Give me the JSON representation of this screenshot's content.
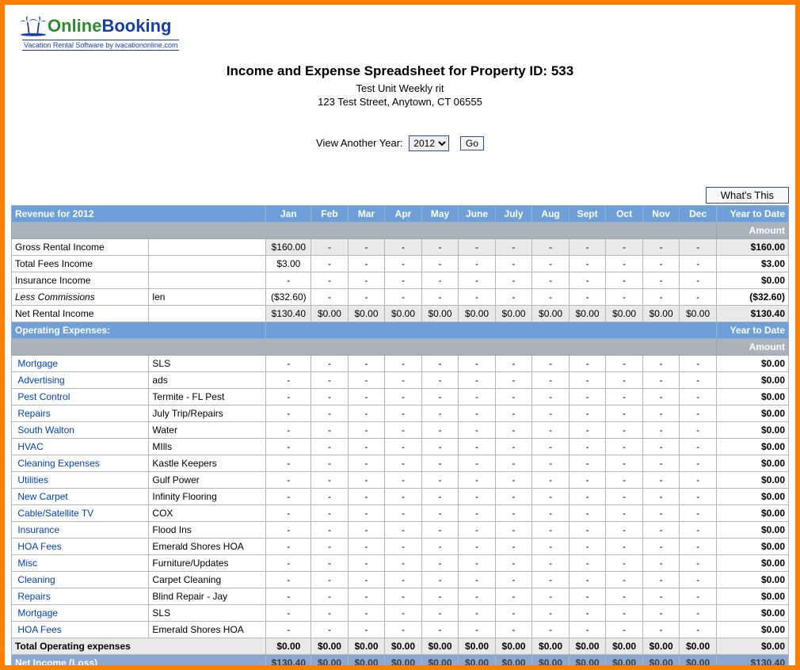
{
  "logo": {
    "text1": "Online",
    "text2": "Booking",
    "tagline": "Vacation Rental Software by ivacationonline.com"
  },
  "header": {
    "title": "Income and Expense Spreadsheet for Property ID: 533",
    "unit": "Test Unit Weekly rit",
    "address": "123 Test Street, Anytown, CT 06555"
  },
  "view_year": {
    "label": "View Another Year:",
    "selected": "2012",
    "go": "Go"
  },
  "whats_this": "What's This",
  "months": [
    "Jan",
    "Feb",
    "Mar",
    "Apr",
    "May",
    "June",
    "July",
    "Aug",
    "Sept",
    "Oct",
    "Nov",
    "Dec"
  ],
  "revenue": {
    "section_label": "Revenue for 2012",
    "ytd_label": "Year to Date",
    "amount_label": "Amount",
    "rows": [
      {
        "label": "Gross Rental Income",
        "desc": "",
        "vals": [
          "$160.00",
          "-",
          "-",
          "-",
          "-",
          "-",
          "-",
          "-",
          "-",
          "-",
          "-",
          "-"
        ],
        "ytd": "$160.00",
        "shade": true
      },
      {
        "label": "Total Fees Income",
        "desc": "",
        "vals": [
          "$3.00",
          "-",
          "-",
          "-",
          "-",
          "-",
          "-",
          "-",
          "-",
          "-",
          "-",
          "-"
        ],
        "ytd": "$3.00"
      },
      {
        "label": "Insurance Income",
        "desc": "",
        "vals": [
          "-",
          "-",
          "-",
          "-",
          "-",
          "-",
          "-",
          "-",
          "-",
          "-",
          "-",
          "-"
        ],
        "ytd": "$0.00"
      },
      {
        "label": "Less Commissions",
        "desc": "len",
        "vals": [
          "($32.60)",
          "-",
          "-",
          "-",
          "-",
          "-",
          "-",
          "-",
          "-",
          "-",
          "-",
          "-"
        ],
        "ytd": "($32.60)",
        "italic": true
      },
      {
        "label": "Net Rental Income",
        "desc": "",
        "vals": [
          "$130.40",
          "$0.00",
          "$0.00",
          "$0.00",
          "$0.00",
          "$0.00",
          "$0.00",
          "$0.00",
          "$0.00",
          "$0.00",
          "$0.00",
          "$0.00"
        ],
        "ytd": "$130.40",
        "shade": true
      }
    ]
  },
  "expenses": {
    "section_label": "Operating Expenses:",
    "ytd_label": "Year to Date",
    "amount_label": "Amount",
    "rows": [
      {
        "label": "Mortgage",
        "desc": "SLS",
        "link": true,
        "ytd": "$0.00"
      },
      {
        "label": "Advertising",
        "desc": "ads",
        "link": true,
        "ytd": "$0.00"
      },
      {
        "label": "Pest Control",
        "desc": "Termite - FL Pest",
        "link": true,
        "ytd": "$0.00"
      },
      {
        "label": "Repairs",
        "desc": "July Trip/Repairs",
        "link": true,
        "ytd": "$0.00"
      },
      {
        "label": "South Walton",
        "desc": "Water",
        "link": true,
        "ytd": "$0.00"
      },
      {
        "label": "HVAC",
        "desc": "MIlls",
        "link": true,
        "ytd": "$0.00"
      },
      {
        "label": "Cleaning Expenses",
        "desc": "Kastle Keepers",
        "link": true,
        "ytd": "$0.00"
      },
      {
        "label": "Utilities",
        "desc": "Gulf Power",
        "link": true,
        "ytd": "$0.00"
      },
      {
        "label": "New Carpet",
        "desc": "Infinity Flooring",
        "link": true,
        "ytd": "$0.00"
      },
      {
        "label": "Cable/Satellite TV",
        "desc": "COX",
        "link": true,
        "ytd": "$0.00"
      },
      {
        "label": "Insurance",
        "desc": "Flood Ins",
        "link": true,
        "ytd": "$0.00"
      },
      {
        "label": "HOA Fees",
        "desc": "Emerald Shores HOA",
        "link": true,
        "ytd": "$0.00"
      },
      {
        "label": "Misc",
        "desc": "Furniture/Updates",
        "link": true,
        "ytd": "$0.00"
      },
      {
        "label": "Cleaning",
        "desc": "Carpet Cleaning",
        "link": true,
        "ytd": "$0.00"
      },
      {
        "label": "Repairs",
        "desc": "Blind Repair - Jay",
        "link": true,
        "ytd": "$0.00"
      },
      {
        "label": "Mortgage",
        "desc": "SLS",
        "link": true,
        "ytd": "$0.00"
      },
      {
        "label": "HOA Fees",
        "desc": "Emerald Shores HOA",
        "link": true,
        "ytd": "$0.00"
      }
    ],
    "total": {
      "label": "Total Operating expenses",
      "vals": [
        "$0.00",
        "$0.00",
        "$0.00",
        "$0.00",
        "$0.00",
        "$0.00",
        "$0.00",
        "$0.00",
        "$0.00",
        "$0.00",
        "$0.00",
        "$0.00"
      ],
      "ytd": "$0.00"
    },
    "net": {
      "label": "Net Income (Loss)",
      "vals": [
        "$130.40",
        "$0.00",
        "$0.00",
        "$0.00",
        "$0.00",
        "$0.00",
        "$0.00",
        "$0.00",
        "$0.00",
        "$0.00",
        "$0.00",
        "$0.00"
      ],
      "ytd": "$130.40"
    }
  },
  "expense_dashes": [
    "-",
    "-",
    "-",
    "-",
    "-",
    "-",
    "-",
    "-",
    "-",
    "-",
    "-",
    "-"
  ]
}
